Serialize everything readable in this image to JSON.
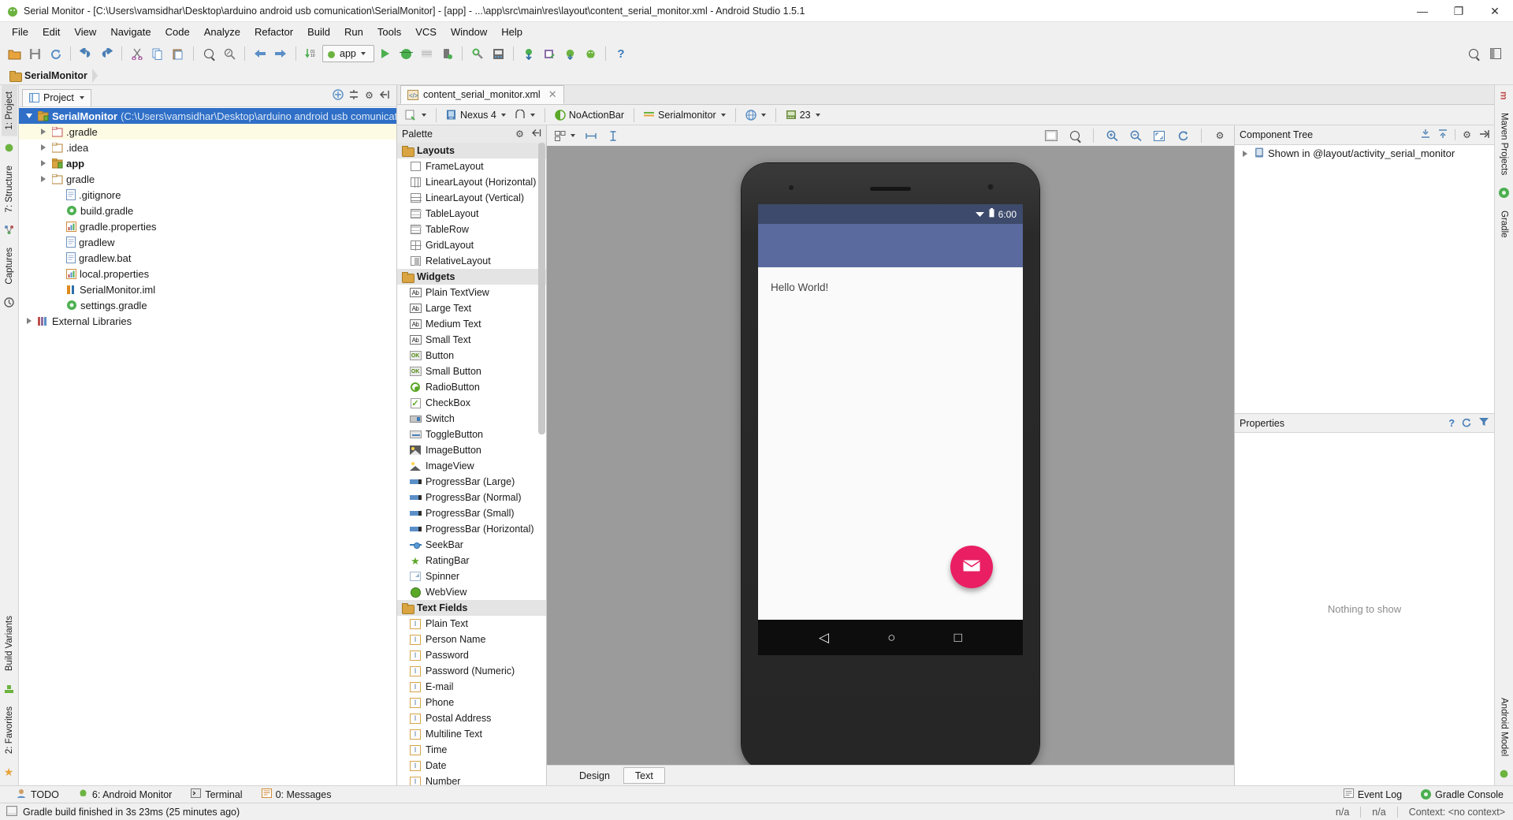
{
  "window": {
    "title": "Serial Monitor - [C:\\Users\\vamsidhar\\Desktop\\arduino android usb comunication\\SerialMonitor] - [app] - ...\\app\\src\\main\\res\\layout\\content_serial_monitor.xml - Android Studio 1.5.1",
    "minimize": "—",
    "maximize": "❐",
    "close": "✕"
  },
  "menubar": {
    "items": [
      "File",
      "Edit",
      "View",
      "Navigate",
      "Code",
      "Analyze",
      "Refactor",
      "Build",
      "Run",
      "Tools",
      "VCS",
      "Window",
      "Help"
    ]
  },
  "toolbar": {
    "run_config": "app",
    "help_label": "?"
  },
  "breadcrumb": {
    "project": "SerialMonitor"
  },
  "left_rail": {
    "top": [
      "1: Project",
      "7: Structure",
      "Captures"
    ],
    "bottom": [
      "Build Variants",
      "2: Favorites"
    ]
  },
  "right_rail": {
    "top": [
      "Maven Projects",
      "Gradle"
    ],
    "bottom": [
      "Android Model"
    ]
  },
  "project_panel": {
    "tab_label": "Project",
    "tree": [
      {
        "label": "SerialMonitor",
        "path": "(C:\\Users\\vamsidhar\\Desktop\\arduino android usb comunication\\SerialMonitor)",
        "icon": "project-folder-icon",
        "indent": 0,
        "arrow": "open",
        "selected": true,
        "bold": true
      },
      {
        "label": ".gradle",
        "path": "",
        "icon": "folder-red-icon",
        "indent": 1,
        "arrow": "closed",
        "selected": false,
        "highlight": true,
        "bold": false
      },
      {
        "label": ".idea",
        "path": "",
        "icon": "folder-icon",
        "indent": 1,
        "arrow": "closed",
        "selected": false,
        "bold": false
      },
      {
        "label": "app",
        "path": "",
        "icon": "module-icon",
        "indent": 1,
        "arrow": "closed",
        "selected": false,
        "bold": true
      },
      {
        "label": "gradle",
        "path": "",
        "icon": "folder-icon",
        "indent": 1,
        "arrow": "closed",
        "selected": false,
        "bold": false
      },
      {
        "label": ".gitignore",
        "path": "",
        "icon": "file-icon",
        "indent": 2,
        "arrow": "none",
        "selected": false,
        "bold": false
      },
      {
        "label": "build.gradle",
        "path": "",
        "icon": "gradle-icon",
        "indent": 2,
        "arrow": "none",
        "selected": false,
        "bold": false
      },
      {
        "label": "gradle.properties",
        "path": "",
        "icon": "properties-icon",
        "indent": 2,
        "arrow": "none",
        "selected": false,
        "bold": false
      },
      {
        "label": "gradlew",
        "path": "",
        "icon": "file-icon",
        "indent": 2,
        "arrow": "none",
        "selected": false,
        "bold": false
      },
      {
        "label": "gradlew.bat",
        "path": "",
        "icon": "file-icon",
        "indent": 2,
        "arrow": "none",
        "selected": false,
        "bold": false
      },
      {
        "label": "local.properties",
        "path": "",
        "icon": "properties-icon",
        "indent": 2,
        "arrow": "none",
        "selected": false,
        "bold": false
      },
      {
        "label": "SerialMonitor.iml",
        "path": "",
        "icon": "iml-icon",
        "indent": 2,
        "arrow": "none",
        "selected": false,
        "bold": false
      },
      {
        "label": "settings.gradle",
        "path": "",
        "icon": "gradle-icon",
        "indent": 2,
        "arrow": "none",
        "selected": false,
        "bold": false
      },
      {
        "label": "External Libraries",
        "path": "",
        "icon": "libraries-icon",
        "indent": 0,
        "arrow": "closed",
        "selected": false,
        "bold": false
      }
    ]
  },
  "editor": {
    "tab": {
      "label": "content_serial_monitor.xml",
      "close": "✕"
    },
    "layout_toolbar": {
      "device": "Nexus 4",
      "orientation": "portrait",
      "theme": "NoActionBar",
      "activity": "Serialmonitor",
      "locale": "locale",
      "api": "23"
    },
    "bottom_tabs": [
      {
        "label": "Design",
        "active": false
      },
      {
        "label": "Text",
        "active": true
      }
    ]
  },
  "palette": {
    "title": "Palette",
    "groups": [
      {
        "name": "Layouts",
        "items": [
          {
            "label": "FrameLayout",
            "icon": "framelayout-icon"
          },
          {
            "label": "LinearLayout (Horizontal)",
            "icon": "linearlayout-horizontal-icon"
          },
          {
            "label": "LinearLayout (Vertical)",
            "icon": "linearlayout-vertical-icon"
          },
          {
            "label": "TableLayout",
            "icon": "tablelayout-icon"
          },
          {
            "label": "TableRow",
            "icon": "tablerow-icon"
          },
          {
            "label": "GridLayout",
            "icon": "gridlayout-icon"
          },
          {
            "label": "RelativeLayout",
            "icon": "relativelayout-icon"
          }
        ]
      },
      {
        "name": "Widgets",
        "items": [
          {
            "label": "Plain TextView",
            "icon": "textview-icon"
          },
          {
            "label": "Large Text",
            "icon": "textview-icon"
          },
          {
            "label": "Medium Text",
            "icon": "textview-icon"
          },
          {
            "label": "Small Text",
            "icon": "textview-icon"
          },
          {
            "label": "Button",
            "icon": "button-icon"
          },
          {
            "label": "Small Button",
            "icon": "button-icon"
          },
          {
            "label": "RadioButton",
            "icon": "radiobutton-icon"
          },
          {
            "label": "CheckBox",
            "icon": "checkbox-icon"
          },
          {
            "label": "Switch",
            "icon": "switch-icon"
          },
          {
            "label": "ToggleButton",
            "icon": "togglebutton-icon"
          },
          {
            "label": "ImageButton",
            "icon": "imagebutton-icon"
          },
          {
            "label": "ImageView",
            "icon": "imageview-icon"
          },
          {
            "label": "ProgressBar (Large)",
            "icon": "progressbar-icon"
          },
          {
            "label": "ProgressBar (Normal)",
            "icon": "progressbar-icon"
          },
          {
            "label": "ProgressBar (Small)",
            "icon": "progressbar-icon"
          },
          {
            "label": "ProgressBar (Horizontal)",
            "icon": "progressbar-icon"
          },
          {
            "label": "SeekBar",
            "icon": "seekbar-icon"
          },
          {
            "label": "RatingBar",
            "icon": "ratingbar-icon"
          },
          {
            "label": "Spinner",
            "icon": "spinner-icon"
          },
          {
            "label": "WebView",
            "icon": "webview-icon"
          }
        ]
      },
      {
        "name": "Text Fields",
        "items": [
          {
            "label": "Plain Text",
            "icon": "textfield-icon"
          },
          {
            "label": "Person Name",
            "icon": "textfield-icon"
          },
          {
            "label": "Password",
            "icon": "textfield-icon"
          },
          {
            "label": "Password (Numeric)",
            "icon": "textfield-icon"
          },
          {
            "label": "E-mail",
            "icon": "textfield-icon"
          },
          {
            "label": "Phone",
            "icon": "textfield-icon"
          },
          {
            "label": "Postal Address",
            "icon": "textfield-icon"
          },
          {
            "label": "Multiline Text",
            "icon": "textfield-icon"
          },
          {
            "label": "Time",
            "icon": "textfield-icon"
          },
          {
            "label": "Date",
            "icon": "textfield-icon"
          },
          {
            "label": "Number",
            "icon": "textfield-icon"
          }
        ]
      }
    ]
  },
  "preview": {
    "status_time": "6:00",
    "wifi_icon": "wifi-icon",
    "battery_icon": "battery-icon",
    "hello_text": "Hello World!",
    "fab_icon": "mail-icon",
    "nav_back": "◁",
    "nav_home": "○",
    "nav_recents": "□",
    "appbar_color": "#5b6a9e",
    "statusbar_color": "#3d4a6b",
    "fab_color": "#e91e63"
  },
  "component_tree": {
    "title": "Component Tree",
    "rows": [
      {
        "label": "Shown in @layout/activity_serial_monitor",
        "icon": "device-icon"
      }
    ]
  },
  "properties": {
    "title": "Properties",
    "empty_text": "Nothing to show",
    "help_label": "?"
  },
  "bottom_bar": {
    "items": [
      {
        "label": "TODO",
        "icon": "todo-icon"
      },
      {
        "label": "6: Android Monitor",
        "icon": "android-icon"
      },
      {
        "label": "Terminal",
        "icon": "terminal-icon"
      },
      {
        "label": "0: Messages",
        "icon": "messages-icon"
      }
    ],
    "right": [
      {
        "label": "Event Log",
        "icon": "event-log-icon"
      },
      {
        "label": "Gradle Console",
        "icon": "gradle-console-icon"
      }
    ]
  },
  "status_bar": {
    "message": "Gradle build finished in 3s 23ms (25 minutes ago)",
    "position": "n/a",
    "encoding": "n/a",
    "context": "Context: <no context>"
  }
}
